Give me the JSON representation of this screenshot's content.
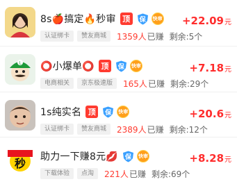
{
  "tasks": [
    {
      "title": "8s🍎搞定🔥秒审",
      "ding": "顶",
      "bao": "保",
      "kuai": "快审",
      "tags": [
        "认证绑卡",
        "赞友商城"
      ],
      "count": "1359人",
      "count_suffix": "已赚",
      "remain": "剩余:5个",
      "price": "+22.09",
      "currency": "元",
      "thumb_icon": "girl-portrait-icon"
    },
    {
      "title": "⭕小爆单⭕",
      "ding": "顶",
      "bao": "保",
      "kuai": "快审",
      "tags": [
        "电商相关",
        "京东极速版"
      ],
      "count": "165人",
      "count_suffix": "已赚",
      "remain": "剩余:29个",
      "price": "+7.18",
      "currency": "元",
      "thumb_icon": "green-cap-character-icon"
    },
    {
      "title": "1s纯实名",
      "ding": "顶",
      "bao": "保",
      "kuai": "快审",
      "tags": [
        "认证绑卡",
        "赞友商城"
      ],
      "count": "2389人",
      "count_suffix": "已赚",
      "remain": "剩余:12个",
      "price": "+20.6",
      "currency": "元",
      "thumb_icon": "child-face-icon"
    },
    {
      "title": "助力一下赚8元💋",
      "ding": "",
      "bao": "保",
      "kuai": "快审",
      "tags": [
        "下载体验",
        "点淘"
      ],
      "count": "221人",
      "count_suffix": "已赚",
      "remain": "剩余:69个",
      "price": "+8.28",
      "currency": "元",
      "thumb_icon": "miao-character-icon",
      "thumb_text": "秒"
    }
  ]
}
